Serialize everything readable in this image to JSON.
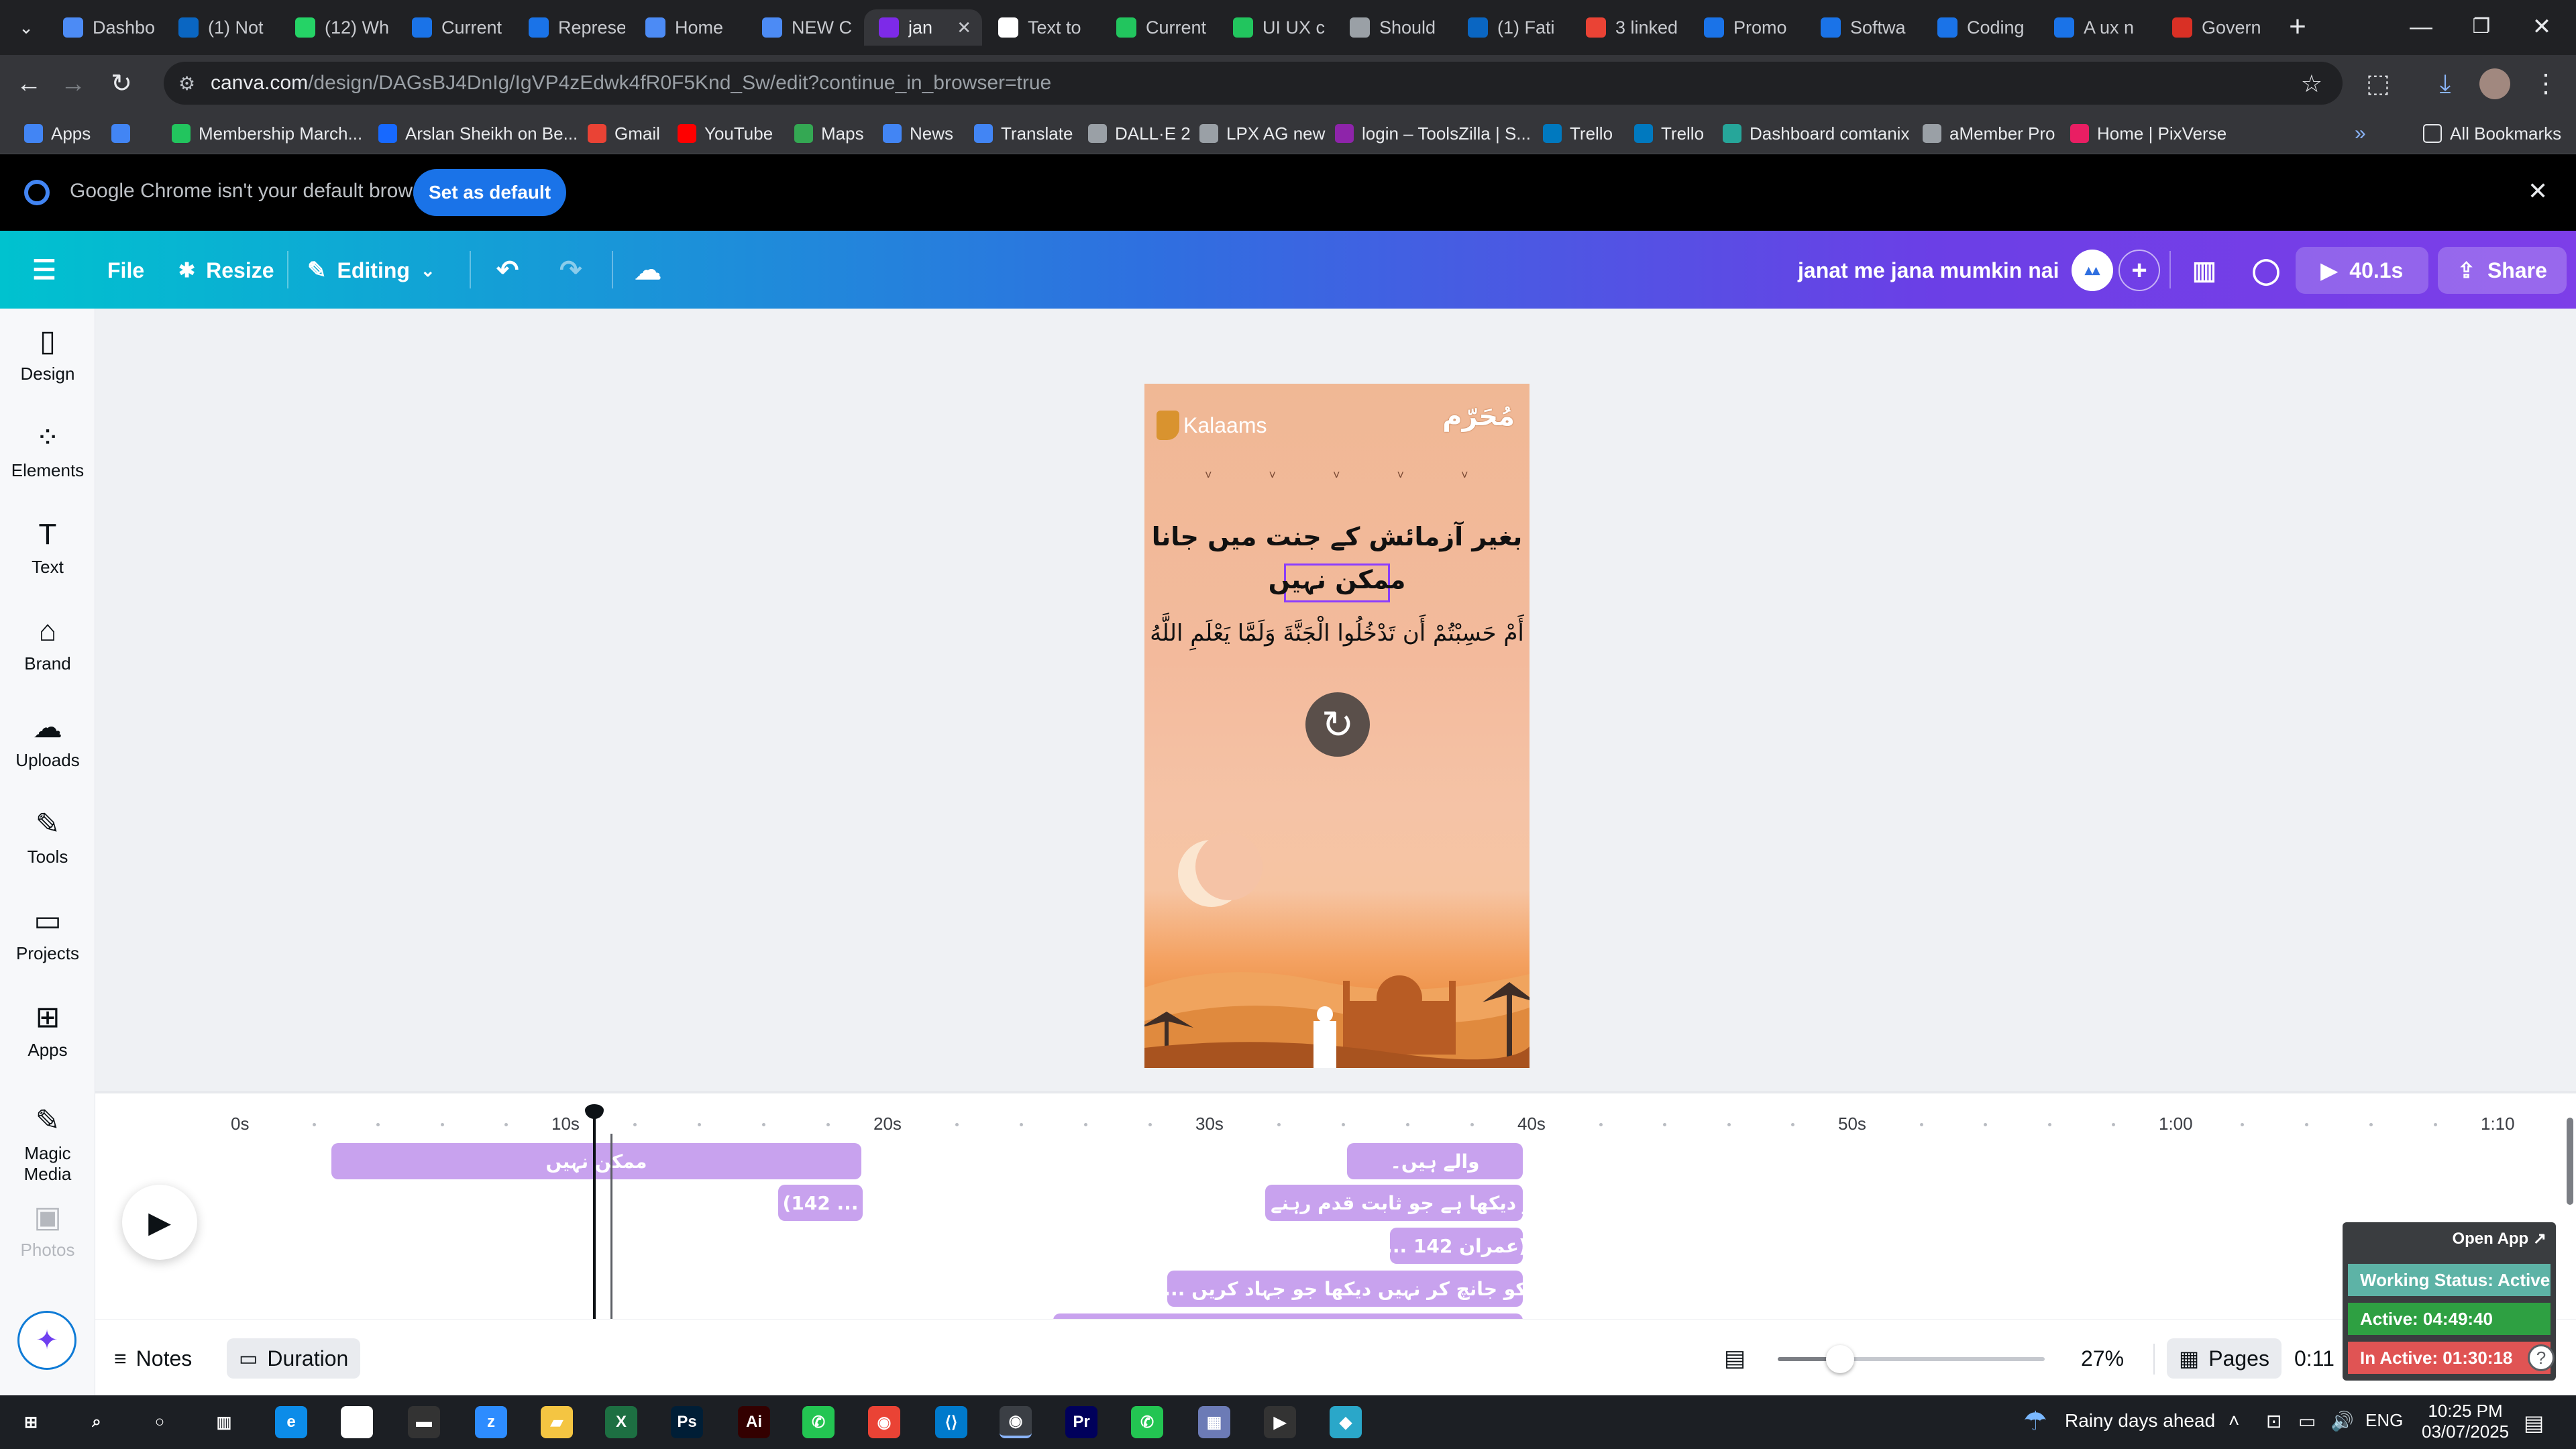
{
  "browser": {
    "tabs": [
      {
        "label": "Dashbo",
        "color": "#4c8bf5"
      },
      {
        "label": "(1) Not",
        "color": "#0a66c2"
      },
      {
        "label": "(12) Wh",
        "color": "#25d366"
      },
      {
        "label": "Current",
        "color": "#1a73e8"
      },
      {
        "label": "Represe",
        "color": "#1a73e8"
      },
      {
        "label": "Home",
        "color": "#4c8bf5"
      },
      {
        "label": "NEW C",
        "color": "#4c8bf5"
      },
      {
        "label": "jan",
        "color": "#7d2ae8"
      },
      {
        "label": "Text to",
        "color": "#ffffff"
      },
      {
        "label": "Current",
        "color": "#22c55e"
      },
      {
        "label": "UI UX c",
        "color": "#22c55e"
      },
      {
        "label": "Should",
        "color": "#9aa0a6"
      },
      {
        "label": "(1) Fati",
        "color": "#0a66c2"
      },
      {
        "label": "3 linked",
        "color": "#ea4335"
      },
      {
        "label": "Promo",
        "color": "#1a73e8"
      },
      {
        "label": "Softwa",
        "color": "#1a73e8"
      },
      {
        "label": "Coding",
        "color": "#1a73e8"
      },
      {
        "label": "A ux n",
        "color": "#1a73e8"
      },
      {
        "label": "Govern",
        "color": "#d93025"
      }
    ],
    "active_tab_index": 7,
    "url_host": "canva.com",
    "url_path": "/design/DAGsBJ4DnIg/IgVP4zEdwk4fR0F5Knd_Sw/edit?continue_in_browser=true",
    "bookmarks": [
      {
        "label": "Apps",
        "color": "#4285f4"
      },
      {
        "label": "",
        "color": "#4285f4"
      },
      {
        "label": "Membership March...",
        "color": "#22c55e"
      },
      {
        "label": "Arslan Sheikh on Be...",
        "color": "#1769ff"
      },
      {
        "label": "Gmail",
        "color": "#ea4335"
      },
      {
        "label": "YouTube",
        "color": "#ff0000"
      },
      {
        "label": "Maps",
        "color": "#34a853"
      },
      {
        "label": "News",
        "color": "#4285f4"
      },
      {
        "label": "Translate",
        "color": "#4285f4"
      },
      {
        "label": "DALL·E 2",
        "color": "#9aa0a6"
      },
      {
        "label": "LPX AG new",
        "color": "#9aa0a6"
      },
      {
        "label": "login – ToolsZilla | S...",
        "color": "#8e24aa"
      },
      {
        "label": "Trello",
        "color": "#0079bf"
      },
      {
        "label": "Trello",
        "color": "#0079bf"
      },
      {
        "label": "Dashboard comtanix",
        "color": "#26a69a"
      },
      {
        "label": "aMember Pro",
        "color": "#9aa0a6"
      },
      {
        "label": "Home | PixVerse",
        "color": "#e91e63"
      }
    ],
    "all_bookmarks": "All Bookmarks",
    "banner_message": "Google Chrome isn't your default browser",
    "banner_button": "Set as default"
  },
  "canva": {
    "header": {
      "file": "File",
      "resize": "Resize",
      "editing": "Editing",
      "project_title": "janat me jana mumkin nai",
      "duration": "40.1s",
      "share": "Share",
      "brand_color_start": "#00c2cf",
      "brand_color_end": "#7d3ee8"
    },
    "sidebar": [
      {
        "label": "Design",
        "icon": "design-icon"
      },
      {
        "label": "Elements",
        "icon": "elements-icon"
      },
      {
        "label": "Text",
        "icon": "text-icon"
      },
      {
        "label": "Brand",
        "icon": "brand-icon"
      },
      {
        "label": "Uploads",
        "icon": "uploads-icon"
      },
      {
        "label": "Tools",
        "icon": "tools-icon"
      },
      {
        "label": "Projects",
        "icon": "projects-icon"
      },
      {
        "label": "Apps",
        "icon": "apps-icon"
      },
      {
        "label": "Magic Media",
        "icon": "magic-media-icon"
      },
      {
        "label": "Photos",
        "icon": "photos-icon"
      }
    ],
    "design": {
      "logo": "Kalaams",
      "corner_logo": "مُحَرّم",
      "line1": "بغیر آزمائش کے جنت میں جانا",
      "line2": "ممکن نہیں",
      "verse": "أَمْ حَسِبْتُمْ أَن تَدْخُلُوا الْجَنَّةَ وَلَمَّا يَعْلَمِ اللَّهُ"
    },
    "timeline": {
      "ticks": [
        "0s",
        "10s",
        "20s",
        "30s",
        "40s",
        "50s",
        "1:00",
        "1:10"
      ],
      "clips": [
        {
          "text": "ممکن نہیں"
        },
        {
          "text": "(142 ..."
        },
        {
          "text": "والے ہیں۔"
        },
        {
          "text": "... کر دیکھا ہے جو ثابت قدم رہنے"
        },
        {
          "text": "... عمران 142)"
        },
        {
          "text": "... کو جانچ کر نہیں دیکھا جو جہاد کریں"
        },
        {
          "text": ""
        }
      ]
    },
    "bottom": {
      "notes": "Notes",
      "duration": "Duration",
      "zoom": "27%",
      "zoom_fraction": 0.27,
      "pages": "Pages",
      "time": "0:11"
    },
    "status_widget": {
      "open_app": "Open App ↗",
      "working": "Working Status: Active",
      "active": "Active: 04:49:40",
      "inactive": "In Active: 01:30:18"
    }
  },
  "taskbar": {
    "weather": "Rainy days ahead",
    "language": "ENG",
    "time": "10:25 PM",
    "date": "03/07/2025",
    "apps": [
      {
        "label": "Windows start",
        "color": "#ffffff"
      },
      {
        "label": "Search",
        "color": "#ffffff"
      },
      {
        "label": "Cortana",
        "color": "#ffffff"
      },
      {
        "label": "Task view",
        "color": "#ffffff"
      },
      {
        "label": "Edge",
        "color": "#0c8ce9"
      },
      {
        "label": "Pen",
        "color": "#ffffff"
      },
      {
        "label": "Terminal",
        "color": "#333333"
      },
      {
        "label": "Zoom",
        "color": "#2d8cff"
      },
      {
        "label": "File Explorer",
        "color": "#f4c542"
      },
      {
        "label": "Excel",
        "color": "#1d6f42"
      },
      {
        "label": "Photoshop",
        "color": "#001e36"
      },
      {
        "label": "Illustrator",
        "color": "#330000"
      },
      {
        "label": "Green app",
        "color": "#23c552"
      },
      {
        "label": "Chrome",
        "color": "#ea4335"
      },
      {
        "label": "VS Code",
        "color": "#007acc"
      },
      {
        "label": "Chrome active",
        "color": "#fbbc05"
      },
      {
        "label": "Premiere Pro",
        "color": "#00005b"
      },
      {
        "label": "Green app 2",
        "color": "#23c552"
      },
      {
        "label": "Calculator",
        "color": "#6c7bb6"
      },
      {
        "label": "Media player",
        "color": "#333333"
      },
      {
        "label": "Teal app",
        "color": "#2aa7c9"
      }
    ]
  }
}
